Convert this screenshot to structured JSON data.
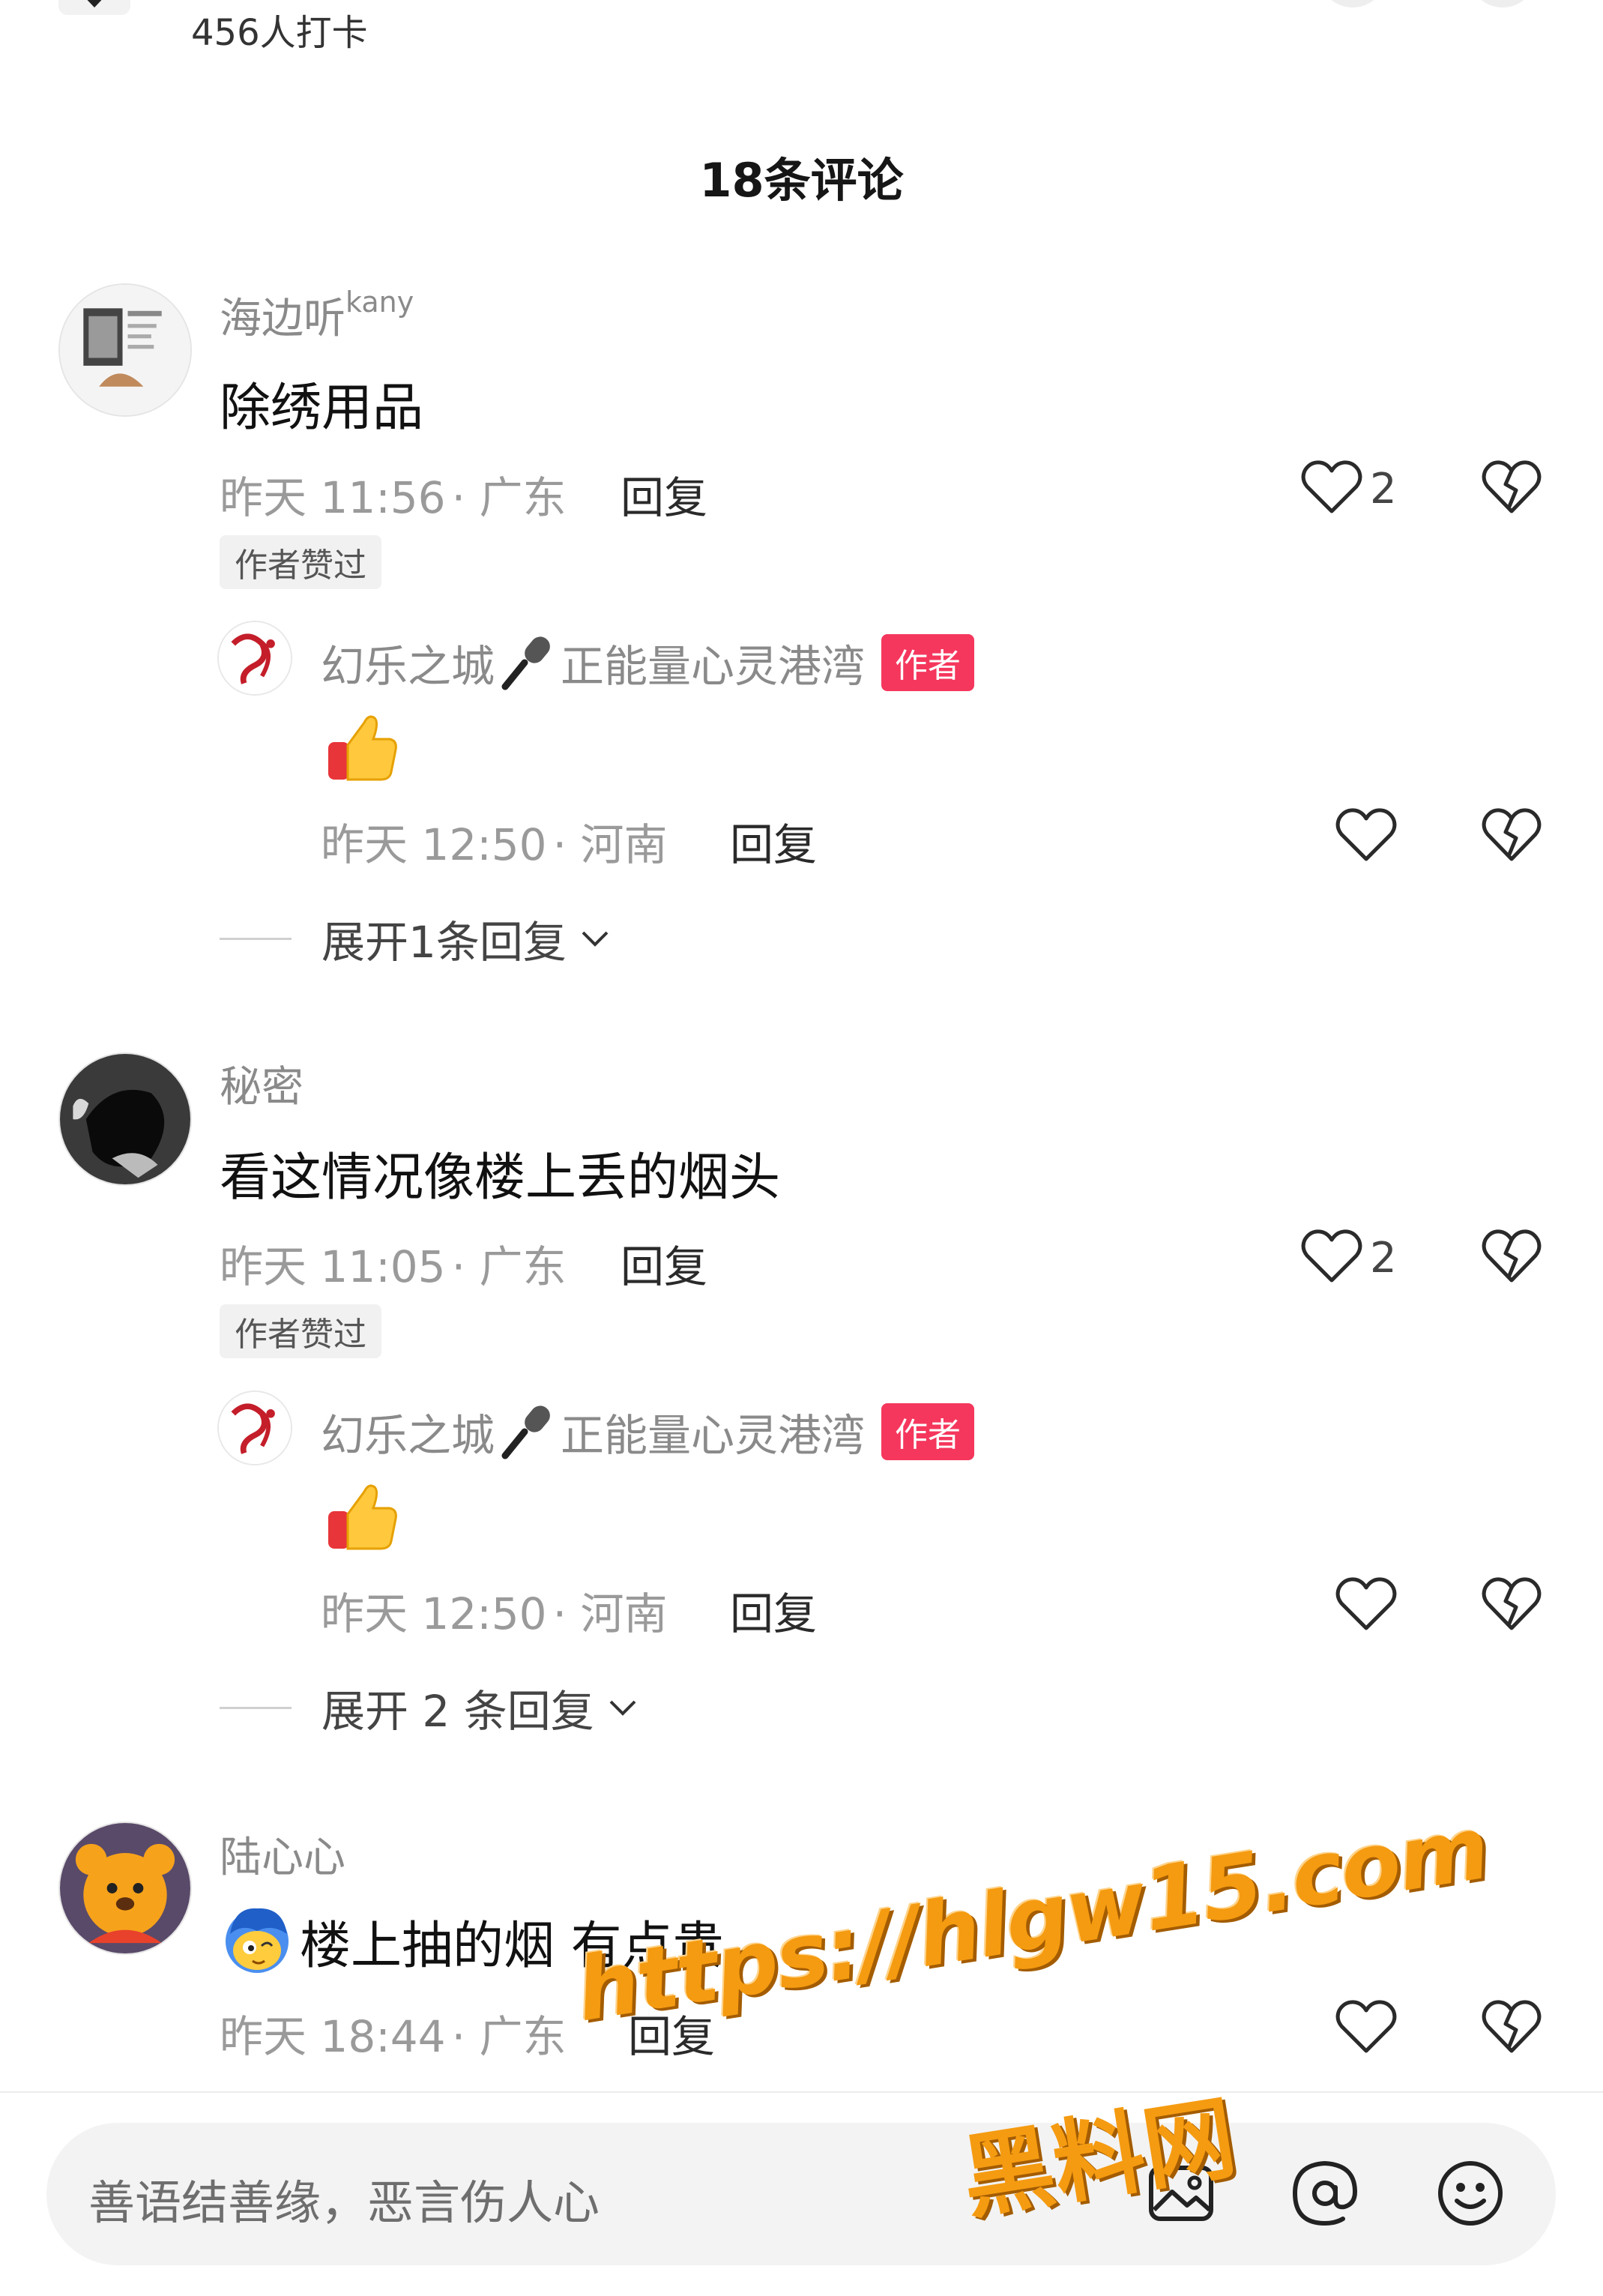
{
  "top": {
    "checkin_text": "456人打卡"
  },
  "comments_header": {
    "count_label": "18条评论"
  },
  "comments": [
    {
      "username": "海边听",
      "username_sup": "kany",
      "text": "除绣用品",
      "time": "昨天 11:56",
      "location": "· 广东",
      "reply_label": "回复",
      "like_count": "2",
      "badge": "作者赞过",
      "reply": {
        "username": "幻乐之城",
        "username_tail": "正能量心灵港湾",
        "author_tag": "作者",
        "time": "昨天 12:50",
        "location": "· 河南",
        "reply_label": "回复"
      },
      "expand_label": "展开1条回复"
    },
    {
      "username": "秘密",
      "text": "看这情况像楼上丢的烟头",
      "time": "昨天 11:05",
      "location": "· 广东",
      "reply_label": "回复",
      "like_count": "2",
      "badge": "作者赞过",
      "reply": {
        "username": "幻乐之城",
        "username_tail": "正能量心灵港湾",
        "author_tag": "作者",
        "time": "昨天 12:50",
        "location": "· 河南",
        "reply_label": "回复"
      },
      "expand_label": "展开 2 条回复"
    },
    {
      "username": "陆心心",
      "text": "楼上抽的烟  有点贵",
      "time": "昨天 18:44",
      "location": "· 广东",
      "reply_label": "回复"
    }
  ],
  "input": {
    "placeholder": "善语结善缘，恶言伤人心"
  },
  "watermark": {
    "url": "https://hlgw15.com",
    "name": "黑料网"
  },
  "colors": {
    "author_tag": "#f5375e",
    "watermark": "#f59b12"
  }
}
